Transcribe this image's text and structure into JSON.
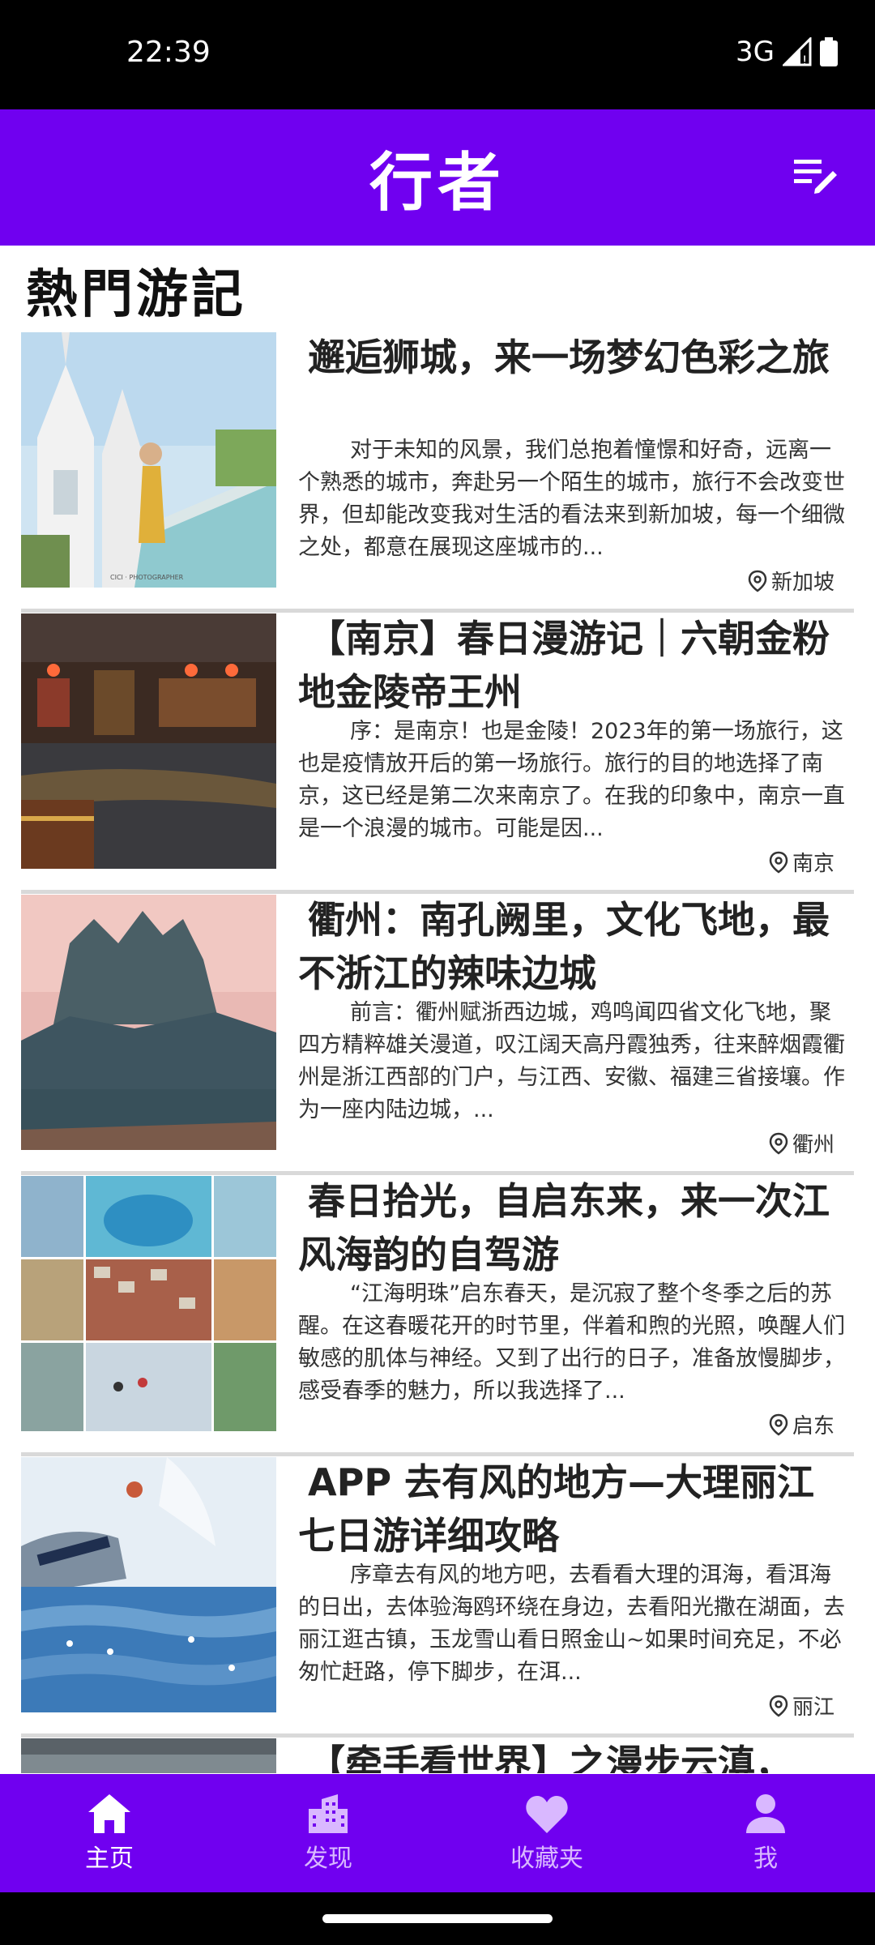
{
  "status_bar": {
    "time": "22:39",
    "network": "3G"
  },
  "app_bar": {
    "title": "行者",
    "menu_icon": "edit-list-icon"
  },
  "section": {
    "title": "熱門游記"
  },
  "posts": [
    {
      "title": "邂逅狮城，来一场梦幻色彩之旅",
      "excerpt": "对于未知的风景，我们总抱着憧憬和好奇，远离一个熟悉的城市，奔赴另一个陌生的城市，旅行不会改变世界，但却能改变我对生活的看法来到新加坡，每一个细微之处，都意在展现这座城市的...",
      "location": "新加坡",
      "thumb_watermark": "CICI · PHOTOGRAPHER"
    },
    {
      "title": "【南京】春日漫游记｜六朝金粉地金陵帝王州",
      "excerpt": "序：是南京！也是金陵！2023年的第一场旅行，这也是疫情放开后的第一场旅行。旅行的目的地选择了南京，这已经是第二次来南京了。在我的印象中，南京一直是一个浪漫的城市。可能是因...",
      "location": "南京"
    },
    {
      "title": "衢州：南孔阙里，文化飞地，最不浙江的辣味边城",
      "excerpt": "前言：衢州赋浙西边城，鸡鸣闻四省文化飞地，聚四方精粹雄关漫道，叹江阔天高丹霞独秀，往来醉烟霞衢州是浙江西部的门户，与江西、安徽、福建三省接壤。作为一座内陆边城，...",
      "location": "衢州"
    },
    {
      "title": "春日拾光，自启东来，来一次江风海韵的自驾游",
      "excerpt": "“江海明珠”启东春天，是沉寂了整个冬季之后的苏醒。在这春暖花开的时节里，伴着和煦的光照，唤醒人们敏感的肌体与神经。又到了出行的日子，准备放慢脚步，感受春季的魅力，所以我选择了...",
      "location": "启东"
    },
    {
      "title": "APP 去有风的地方—大理丽江七日游详细攻略",
      "excerpt": "序章去有风的地方吧，去看看大理的洱海，看洱海的日出，去体验海鸥环绕在身边，去看阳光撒在湖面，去丽江逛古镇，玉龙雪山看日照金山~如果时间充足，不必匆忙赶路，停下脚步，在洱...",
      "location": "丽江"
    },
    {
      "title": "【牵手看世界】之漫步云滇，",
      "excerpt": "",
      "location": ""
    }
  ],
  "bottom_nav": [
    {
      "label": "主页",
      "icon": "home-icon",
      "active": true
    },
    {
      "label": "发现",
      "icon": "city-icon",
      "active": false
    },
    {
      "label": "收藏夹",
      "icon": "heart-icon",
      "active": false
    },
    {
      "label": "我",
      "icon": "person-icon",
      "active": false
    }
  ],
  "colors": {
    "primary": "#7000f0",
    "nav_inactive": "#d9b8ff",
    "divider": "#d9d9d9"
  }
}
